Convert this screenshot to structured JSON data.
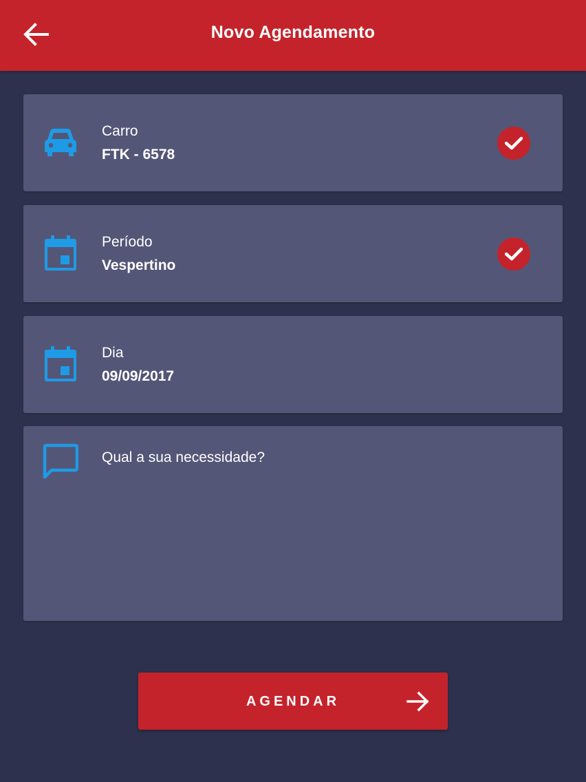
{
  "header": {
    "title": "Novo Agendamento",
    "back_icon": "arrow-left-icon"
  },
  "colors": {
    "primary_red": "#c4232b",
    "background": "#2e314d",
    "card": "#545677",
    "icon_blue": "#1e9be6"
  },
  "fields": [
    {
      "icon": "car-icon",
      "label": "Carro",
      "value": "FTK - 6578",
      "confirmed": true
    },
    {
      "icon": "calendar-icon",
      "label": "Período",
      "value": "Vespertino",
      "confirmed": true
    },
    {
      "icon": "calendar-icon",
      "label": "Dia",
      "value": "09/09/2017",
      "confirmed": false
    }
  ],
  "message": {
    "icon": "chat-bubble-icon",
    "placeholder": "Qual a sua necessidade?",
    "value": ""
  },
  "submit": {
    "label": "AGENDAR",
    "icon": "arrow-right-icon"
  }
}
